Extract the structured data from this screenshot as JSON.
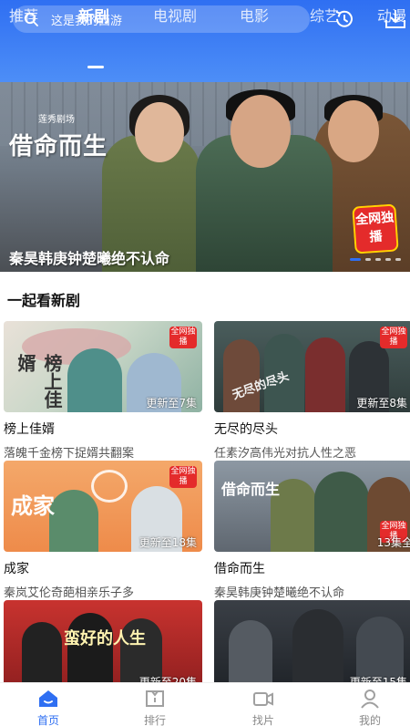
{
  "search": {
    "placeholder": "这是我的西游"
  },
  "header": {
    "history_icon": "history-icon",
    "download_icon": "download-icon"
  },
  "tabs": [
    {
      "label": "推荐"
    },
    {
      "label": "新剧",
      "active": true
    },
    {
      "label": "电视剧"
    },
    {
      "label": "电影"
    },
    {
      "label": "综艺"
    },
    {
      "label": "动漫"
    }
  ],
  "banner": {
    "studio": "莲秀剧场",
    "title": "借命而生",
    "badge": "全网独播",
    "caption": "秦昊韩庚钟楚曦绝不认命",
    "dots": 5,
    "active_dot": 0
  },
  "section": {
    "title": "一起看新剧"
  },
  "cards": [
    {
      "title": "榜上佳婿",
      "desc": "落魄千金榜下捉婿共翻案",
      "episode": "更新至7集",
      "badge": "全网独播",
      "thumb_title": "榜上佳婿"
    },
    {
      "title": "无尽的尽头",
      "desc": "任素汐高伟光对抗人性之恶",
      "episode": "更新至8集",
      "badge": "全网独播",
      "thumb_title": "无尽的尽头"
    },
    {
      "title": "成家",
      "desc": "秦岚艾伦奇葩相亲乐子多",
      "episode": "更新至18集",
      "badge": "全网独播",
      "thumb_title": "成家"
    },
    {
      "title": "借命而生",
      "desc": "秦昊韩庚钟楚曦绝不认命",
      "episode": "13集全",
      "badge": "全网独播",
      "thumb_title": "借命而生"
    },
    {
      "title": "",
      "desc": "",
      "episode": "更新至20集",
      "badge": "",
      "thumb_title": "蛮好的人生"
    },
    {
      "title": "",
      "desc": "",
      "episode": "更新至15集",
      "badge": "",
      "thumb_title": ""
    }
  ],
  "nav": [
    {
      "label": "首页",
      "icon": "home-icon",
      "active": true
    },
    {
      "label": "排行",
      "icon": "ranking-icon"
    },
    {
      "label": "找片",
      "icon": "video-camera-icon"
    },
    {
      "label": "我的",
      "icon": "profile-icon"
    }
  ],
  "colors": {
    "brand": "#2f6ff2",
    "badge_red": "#e42b2b"
  }
}
